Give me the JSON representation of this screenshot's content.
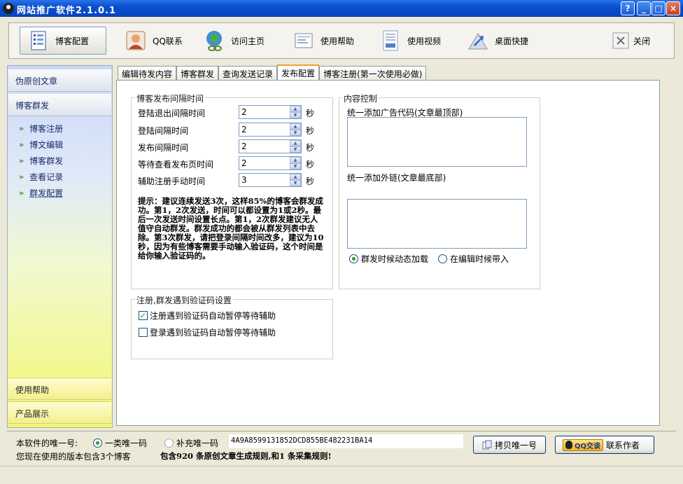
{
  "window": {
    "title": "网站推广软件2.1.0.1",
    "buttons": {
      "help": "?",
      "minimize": "_",
      "maximize": "□",
      "close": "×"
    }
  },
  "toolbar": {
    "items": [
      {
        "label": "博客配置",
        "icon": "document-list-icon"
      },
      {
        "label": "QQ联系",
        "icon": "user-avatar-icon"
      },
      {
        "label": "访问主页",
        "icon": "globe-link-icon"
      },
      {
        "label": "使用帮助",
        "icon": "help-document-icon"
      },
      {
        "label": "使用视频",
        "icon": "video-document-icon"
      },
      {
        "label": "桌面快捷",
        "icon": "shortcut-arrow-icon"
      },
      {
        "label": "关闭",
        "icon": "close-x-icon"
      }
    ]
  },
  "sidebar": {
    "sections": [
      "伪原创文章",
      "博客群发"
    ],
    "items": [
      "博客注册",
      "博文编辑",
      "博客群发",
      "查看记录",
      "群发配置"
    ],
    "active_item": "群发配置",
    "bottom_sections": [
      "使用帮助",
      "产品展示"
    ]
  },
  "tabs": [
    "编辑待发内容",
    "博客群发",
    "查询发送记录",
    "发布配置",
    "博客注册(第一次使用必做)"
  ],
  "active_tab": "发布配置",
  "interval_group": {
    "title": "博客发布间隔时间",
    "rows": [
      {
        "label": "登陆退出间隔时间",
        "value": "2",
        "unit": "秒"
      },
      {
        "label": "登陆间隔时间",
        "value": "2",
        "unit": "秒"
      },
      {
        "label": "发布间隔时间",
        "value": "2",
        "unit": "秒"
      },
      {
        "label": "等待查看发布页时间",
        "value": "2",
        "unit": "秒"
      },
      {
        "label": "辅助注册手动时间",
        "value": "3",
        "unit": "秒"
      }
    ],
    "tip": "提示：建议连续发送3次，这样85%的博客会群发成功。第1，2次发送，时间可以都设置为1或2秒。最后一次发送时间设置长点。第1，2次群发建议无人值守自动群发。群发成功的都会被从群发列表中去除。第3次群发，请把登录间隔时间改多，建议为10秒，因为有些博客需要手动输入验证码，这个时间是给你输入验证码的。"
  },
  "content_group": {
    "title": "内容控制",
    "ad_label": "统一添加广告代码(文章最顶部)",
    "ad_value": "",
    "link_label": "统一添加外链(文章最底部)",
    "link_value": "",
    "radio_options": [
      "群发时候动态加载",
      "在编辑时候带入"
    ],
    "radio_selected": 0
  },
  "captcha_group": {
    "title": "注册,群发遇到验证码设置",
    "options": [
      {
        "label": "注册遇到验证码自动暂停等待辅助",
        "checked": true
      },
      {
        "label": "登录遇到验证码自动暂停等待辅助",
        "checked": false
      }
    ]
  },
  "footer": {
    "id_label": "本软件的唯一号:",
    "id_options": [
      "一类唯一码",
      "补充唯一码"
    ],
    "id_selected": 0,
    "id_value": "4A9A8599131852DCD855BE482231BA14",
    "copy_button": "拷贝唯一号",
    "qq_badge": "QQ交谈",
    "contact_label": "联系作者",
    "version_info": "您现在使用的版本包含3个博客",
    "rules_info": "包含920 条原创文章生成规则,和1 条采集规则!"
  }
}
